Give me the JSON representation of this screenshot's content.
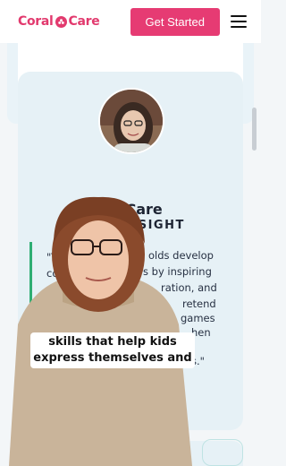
{
  "header": {
    "logo_part1": "Coral",
    "logo_part2": "Care",
    "cta_label": "Get Started",
    "menu_icon": "hamburger-menu-icon"
  },
  "testimonial": {
    "brand_part1": "l",
    "brand_part2": "Care",
    "heading": "INSIGHT",
    "quote_lines": [
      "\"T",
      "co",
      "",
      "",
      "",
      "",
      ""
    ],
    "quote_right_lines": [
      "olds develop",
      "s by inspiring",
      "ration, and",
      "retend",
      "games",
      "hen",
      "s.\""
    ]
  },
  "caption": {
    "line1": "skills that help kids",
    "line2": "express themselves and"
  },
  "colors": {
    "brand": "#e23a6e",
    "cta": "#e63b73",
    "accent_green": "#2fae73",
    "card_bg": "#e6f1f6"
  }
}
